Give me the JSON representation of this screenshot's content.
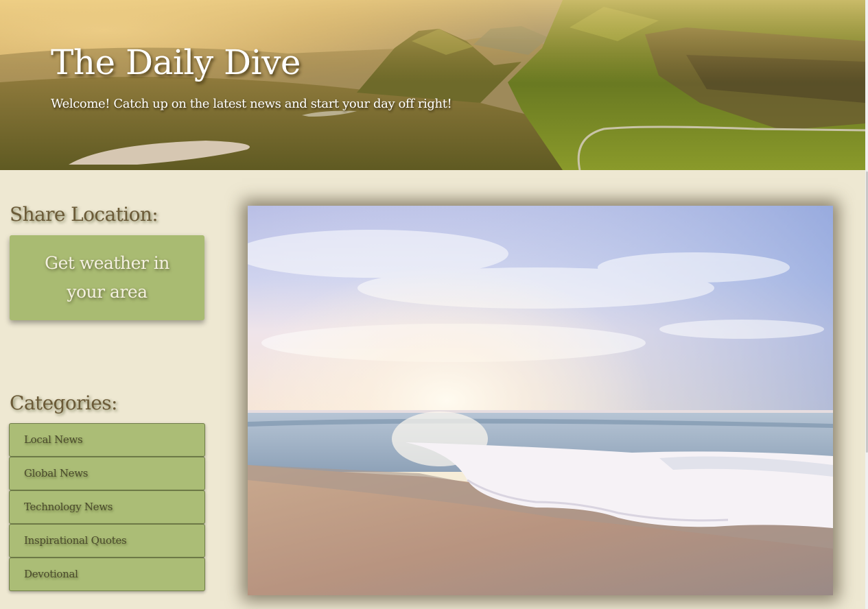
{
  "header": {
    "title": "The Daily Dive",
    "subtitle": "Welcome! Catch up on the latest news and start your day off right!",
    "background_image": "mountain-landscape-image"
  },
  "sidebar": {
    "location_heading": "Share Location:",
    "weather_button_label": "Get weather in your area",
    "categories_heading": "Categories:",
    "categories": [
      {
        "label": "Local News"
      },
      {
        "label": "Global News"
      },
      {
        "label": "Technology News"
      },
      {
        "label": "Inspirational Quotes"
      },
      {
        "label": "Devotional"
      }
    ]
  },
  "main": {
    "feature_image": "beach-sunrise-image"
  },
  "colors": {
    "page_background": "#eee8d2",
    "button_green": "#a9bb72",
    "category_green": "#abbd76",
    "heading_brown": "#6b5a37"
  }
}
